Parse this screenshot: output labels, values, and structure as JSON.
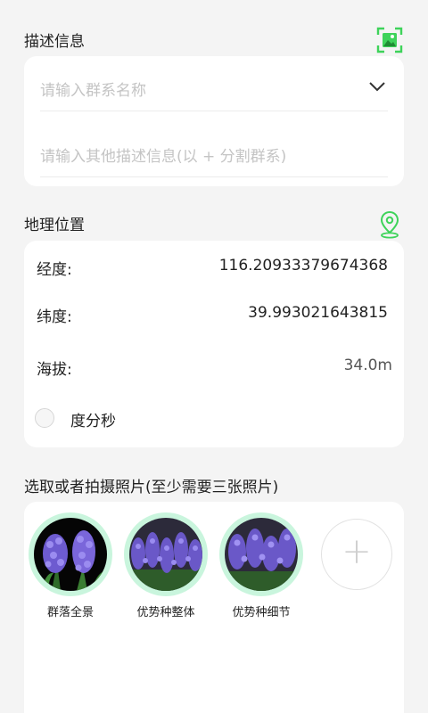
{
  "description": {
    "title": "描述信息",
    "group_name_placeholder": "请输入群系名称",
    "other_info_placeholder": "请输入其他描述信息(以 + 分割群系)"
  },
  "location": {
    "title": "地理位置",
    "longitude_label": "经度:",
    "longitude_value": "116.20933379674368",
    "latitude_label": "纬度:",
    "latitude_value": "39.993021643815",
    "altitude_label": "海拔:",
    "altitude_value": "34.0m",
    "dms_label": "度分秒",
    "dms_checked": false
  },
  "photos": {
    "title": "选取或者拍摄照片(至少需要三张照片)",
    "items": [
      {
        "caption": "群落全景"
      },
      {
        "caption": "优势种整体"
      },
      {
        "caption": "优势种细节"
      }
    ],
    "add_symbol": "+"
  },
  "colors": {
    "accent_green": "#3ed35a",
    "photo_ring": "#c9f5dd",
    "card_bg": "#ffffff",
    "page_bg": "#f4f4f4"
  },
  "icons": {
    "image_scan": "image-scan-icon",
    "location_pin": "location-pin-icon",
    "dropdown": "chevron-down-icon"
  }
}
